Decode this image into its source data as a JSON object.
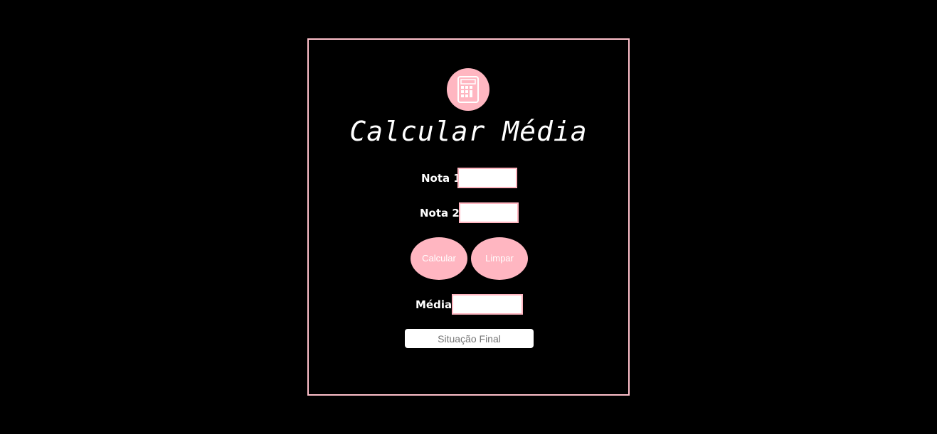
{
  "app": {
    "title": "Calcular Média",
    "logo_icon": "calculator-icon"
  },
  "form": {
    "nota1_label": "Nota 1",
    "nota1_value": "",
    "nota2_label": "Nota 2",
    "nota2_value": "",
    "calcular_label": "Calcular",
    "limpar_label": "Limpar",
    "media_label": "Média",
    "media_value": "",
    "situacao_placeholder": "Situação Final",
    "situacao_value": ""
  },
  "colors": {
    "background": "#000000",
    "accent": "#ffb6c1",
    "border": "#ffc0cb",
    "text": "#ffffff"
  }
}
